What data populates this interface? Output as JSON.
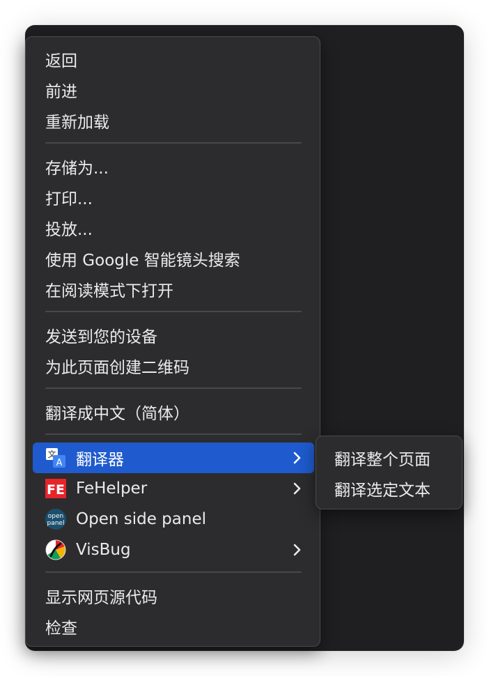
{
  "context_menu": {
    "groups": [
      [
        "返回",
        "前进",
        "重新加载"
      ],
      [
        "存储为...",
        "打印...",
        "投放...",
        "使用 Google 智能镜头搜索",
        "在阅读模式下打开"
      ],
      [
        "发送到您的设备",
        "为此页面创建二维码"
      ],
      [
        "翻译成中文（简体）"
      ]
    ],
    "extensions": [
      {
        "label": "翻译器",
        "icon": "translate-icon",
        "has_submenu": true,
        "highlighted": true
      },
      {
        "label": "FeHelper",
        "icon": "fehelper-icon",
        "has_submenu": true,
        "highlighted": false
      },
      {
        "label": "Open side panel",
        "icon": "open-panel-icon",
        "has_submenu": false,
        "highlighted": false
      },
      {
        "label": "VisBug",
        "icon": "visbug-icon",
        "has_submenu": true,
        "highlighted": false
      }
    ],
    "fehelper_icon_text": "FE",
    "open_panel_icon_text": [
      "open",
      "panel"
    ],
    "bottom": [
      "显示网页源代码",
      "检查"
    ]
  },
  "submenu": {
    "items": [
      "翻译整个页面",
      "翻译选定文本"
    ]
  },
  "colors": {
    "highlight": "#1f5bce",
    "menu_bg": "#2c2c2e",
    "window_bg": "#1f1f22",
    "text": "#ebebeb"
  }
}
